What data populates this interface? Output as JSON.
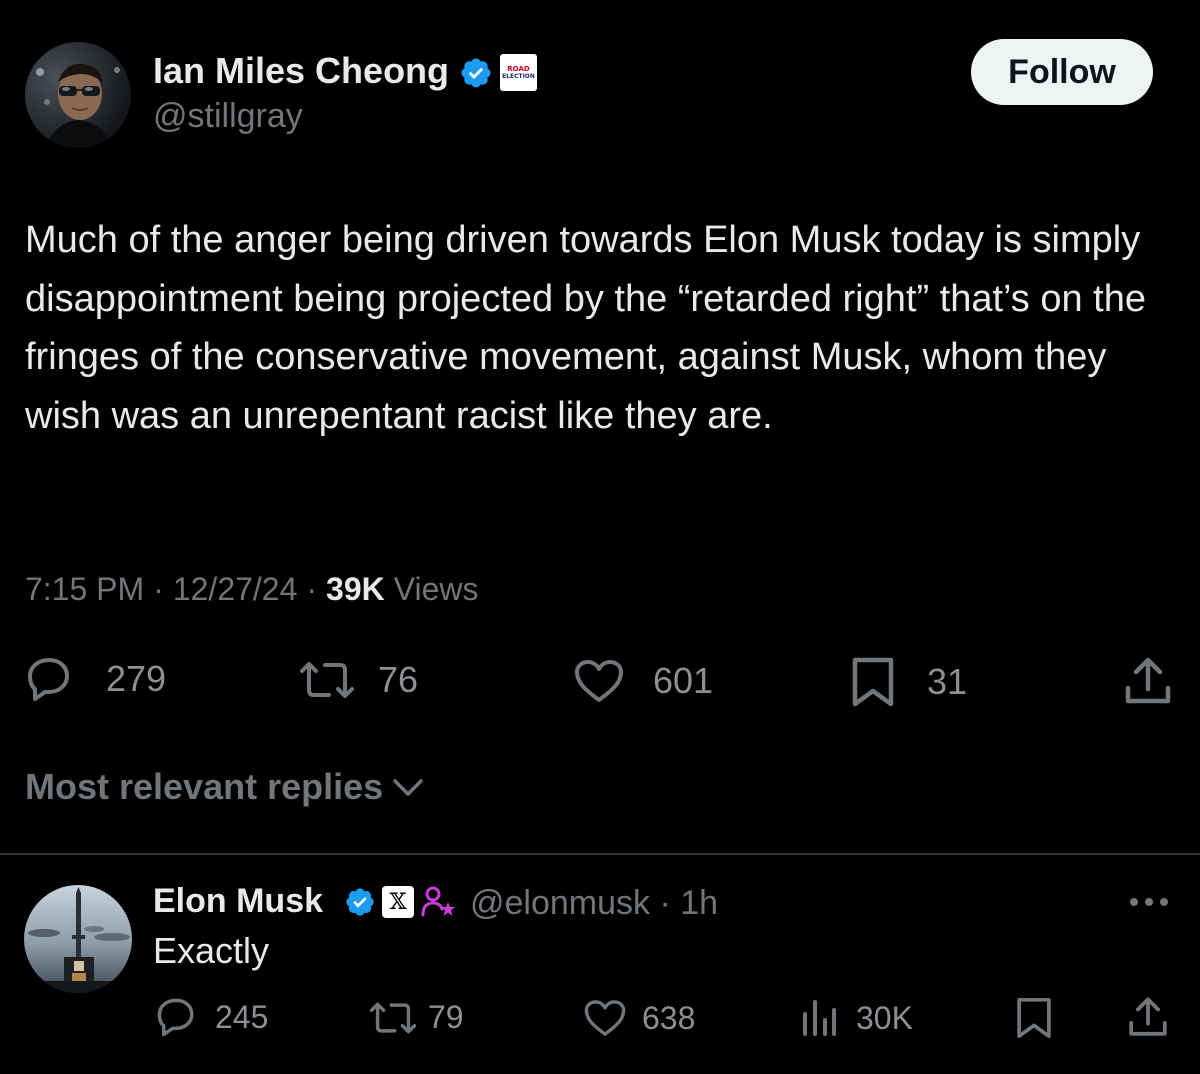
{
  "tweet": {
    "author": {
      "name": "Ian Miles Cheong",
      "handle": "@stillgray",
      "affiliation_badge": [
        "ROAD",
        "ELECTION"
      ]
    },
    "follow_label": "Follow",
    "text": "Much of the anger being driven towards Elon Musk today is simply disappointment being projected by the “retarded right” that’s on the fringes of the conservative movement, against Musk, whom they wish was an unrepentant racist like they are.",
    "time": "7:15 PM",
    "date": "12/27/24",
    "views_count": "39K",
    "views_label": "Views",
    "separator": "·",
    "stats": {
      "replies": "279",
      "reposts": "76",
      "likes": "601",
      "bookmarks": "31"
    }
  },
  "replies_section": {
    "label": "Most relevant replies"
  },
  "reply": {
    "author": {
      "name": "Elon Musk",
      "handle": "@elonmusk",
      "x_badge": "𝕏"
    },
    "age": "· 1h",
    "text": "Exactly",
    "stats": {
      "replies": "245",
      "reposts": "79",
      "likes": "638",
      "views": "30K"
    }
  },
  "icons": {
    "verified": "verified-badge-icon",
    "reply": "reply-bubble-icon",
    "repost": "repost-icon",
    "like": "heart-icon",
    "bookmark": "bookmark-icon",
    "share": "share-icon",
    "views": "bar-chart-icon",
    "more": "more-dots-icon",
    "chevron": "chevron-down-icon"
  },
  "colors": {
    "background": "#000000",
    "text_primary": "#e7e9ea",
    "text_secondary": "#71767b",
    "verified_blue": "#1d9bf0",
    "follow_button_bg": "#eff3f4",
    "divider": "#2f3336",
    "people_badge": "#c93cd8"
  }
}
